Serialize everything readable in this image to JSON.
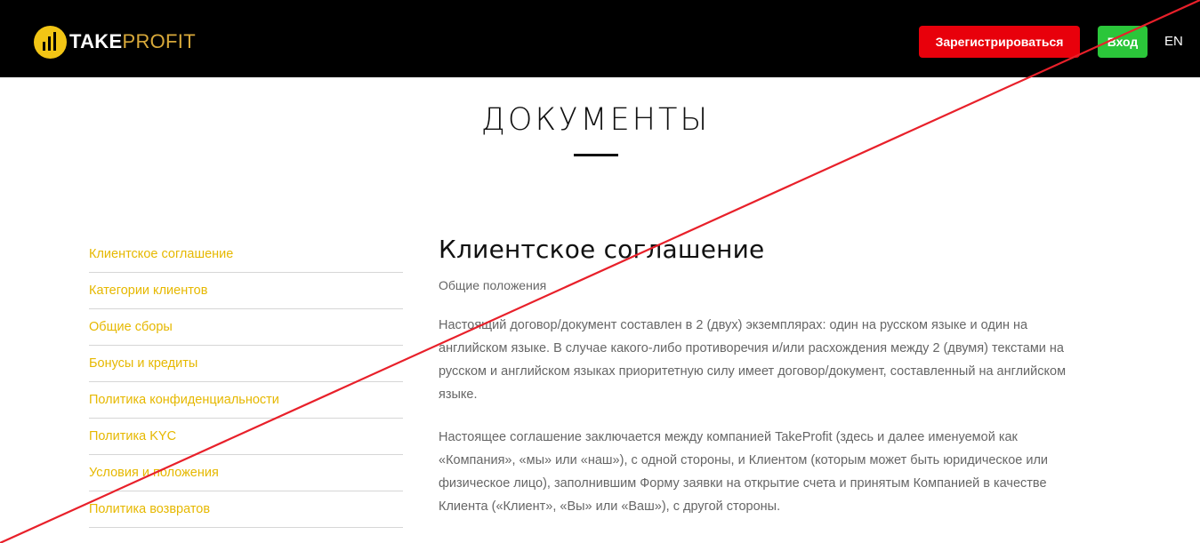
{
  "header": {
    "logo_take": "TAKE",
    "logo_profit": "PROFIT",
    "register_label": "Зарегистрироваться",
    "login_label": "Вход",
    "lang_label": "EN",
    "colors": {
      "background": "#000000",
      "register_button": "#e8000b",
      "login_button": "#2bc63a",
      "logo_accent": "#f2c515"
    }
  },
  "page": {
    "title": "ДОКУМЕНТЫ"
  },
  "sidebar": {
    "link_color": "#e6b800",
    "items": [
      {
        "label": "Клиентское соглашение"
      },
      {
        "label": "Категории клиентов"
      },
      {
        "label": "Общие сборы"
      },
      {
        "label": "Бонусы и кредиты"
      },
      {
        "label": "Политика конфиденциальности"
      },
      {
        "label": "Политика KYC"
      },
      {
        "label": "Условия и положения"
      },
      {
        "label": "Политика возвратов"
      }
    ]
  },
  "content": {
    "heading": "Клиентское соглашение",
    "subheading": "Общие положения",
    "paragraphs": [
      "Настоящий договор/документ составлен в 2 (двух) экземплярах: один на русском языке и один на английском языке. В случае какого-либо противоречия и/или расхождения между 2 (двумя) текстами на русском и английском языках приоритетную силу имеет договор/документ, составленный на английском языке.",
      "Настоящее соглашение заключается между компанией TakeProfit (здесь и далее именуемой как «Компания», «мы» или «наш»), с одной стороны, и Клиентом (которым может быть юридическое или физическое лицо), заполнившим Форму заявки на открытие счета и принятым Компанией в качестве Клиента («Клиент», «Вы» или «Ваш»), с другой стороны."
    ]
  },
  "overlay": {
    "color": "#e8202a"
  }
}
